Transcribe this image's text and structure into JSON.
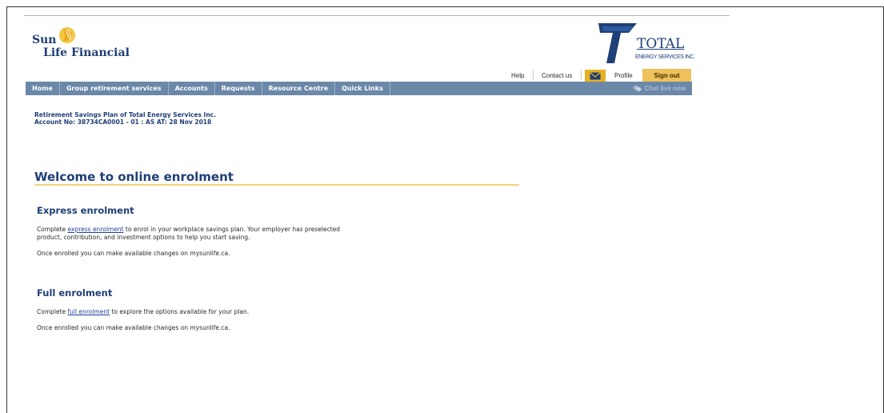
{
  "branding": {
    "sunlife_top": "Sun",
    "sunlife_bottom": "Life Financial",
    "total_name": "TOTAL",
    "total_sub": "ENERGY SERVICES INC."
  },
  "utility": {
    "help": "Help",
    "contact": "Contact us",
    "profile": "Profile",
    "sign_out": "Sign out"
  },
  "nav": {
    "items": [
      "Home",
      "Group retirement services",
      "Accounts",
      "Requests",
      "Resource Centre",
      "Quick Links"
    ],
    "chat": "Chat live now"
  },
  "account": {
    "plan": "Retirement Savings Plan of Total Energy Services Inc.",
    "number": "Account No: 38734CA0001 - 01 : AS AT: 28 Nov 2018"
  },
  "welcome": {
    "title": "Welcome to online enrolment"
  },
  "express": {
    "title": "Express enrolment",
    "p1_pre": "Complete ",
    "p1_link": "express enrolment",
    "p1_post1": " to enrol in your workplace savings plan. Your employer has preselected",
    "p1_post2": "product, contribution, and investment options to help you start saving.",
    "p2": "Once enrolled you can make available changes on mysunlife.ca."
  },
  "full": {
    "title": "Full enrolment",
    "p1_pre": "Complete ",
    "p1_link": "full enrolment",
    "p1_post": " to explore the options available for your plan.",
    "p2": "Once enrolled you can make available changes on mysunlife.ca."
  },
  "colors": {
    "brand_blue": "#1f3f77",
    "nav_bg": "#6b88a8",
    "gold": "#efc15a"
  }
}
